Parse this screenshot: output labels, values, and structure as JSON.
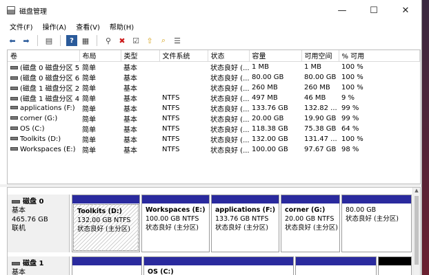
{
  "window": {
    "title": "磁盘管理",
    "minimize": "—",
    "maximize": "☐",
    "close": "✕"
  },
  "menu": [
    "文件(F)",
    "操作(A)",
    "查看(V)",
    "帮助(H)"
  ],
  "toolbar": {
    "icons": [
      "back-arrow-icon",
      "forward-arrow-icon",
      "properties-grid-icon",
      "help-icon",
      "console-tree-icon",
      "connect-icon",
      "delete-icon",
      "checklist-icon",
      "folder-up-icon",
      "search-folder-icon",
      "details-list-icon"
    ]
  },
  "table": {
    "columns": [
      "卷",
      "布局",
      "类型",
      "文件系统",
      "状态",
      "容量",
      "可用空间",
      "% 可用"
    ],
    "rows": [
      [
        "(磁盘 0 磁盘分区 5)",
        "简单",
        "基本",
        "",
        "状态良好 (...",
        "1 MB",
        "1 MB",
        "100 %"
      ],
      [
        "(磁盘 0 磁盘分区 6)",
        "简单",
        "基本",
        "",
        "状态良好 (...",
        "80.00 GB",
        "80.00 GB",
        "100 %"
      ],
      [
        "(磁盘 1 磁盘分区 2)",
        "简单",
        "基本",
        "",
        "状态良好 (...",
        "260 MB",
        "260 MB",
        "100 %"
      ],
      [
        "(磁盘 1 磁盘分区 4)",
        "简单",
        "基本",
        "NTFS",
        "状态良好 (...",
        "497 MB",
        "46 MB",
        "9 %"
      ],
      [
        "applications (F:)",
        "简单",
        "基本",
        "NTFS",
        "状态良好 (...",
        "133.76 GB",
        "132.82 ...",
        "99 %"
      ],
      [
        "corner (G:)",
        "简单",
        "基本",
        "NTFS",
        "状态良好 (...",
        "20.00 GB",
        "19.90 GB",
        "99 %"
      ],
      [
        "OS (C:)",
        "简单",
        "基本",
        "NTFS",
        "状态良好 (...",
        "118.38 GB",
        "75.38 GB",
        "64 %"
      ],
      [
        "Toolkits (D:)",
        "简单",
        "基本",
        "NTFS",
        "状态良好 (...",
        "132.00 GB",
        "131.47 ...",
        "100 %"
      ],
      [
        "Workspaces (E:)",
        "简单",
        "基本",
        "NTFS",
        "状态良好 (...",
        "100.00 GB",
        "97.67 GB",
        "98 %"
      ]
    ]
  },
  "disks": [
    {
      "name": "磁盘 0",
      "type": "基本",
      "size": "465.76 GB",
      "status": "联机",
      "partitions": [
        {
          "name": "Toolkits (D:)",
          "size": "132.00 GB NTFS",
          "status": "状态良好 (主分区)"
        },
        {
          "name": "Workspaces (E:)",
          "size": "100.00 GB NTFS",
          "status": "状态良好 (主分区)"
        },
        {
          "name": "applications (F:)",
          "size": "133.76 GB NTFS",
          "status": "状态良好 (主分区)"
        },
        {
          "name": "corner (G:)",
          "size": "20.00 GB NTFS",
          "status": "状态良好 (主分区)"
        },
        {
          "name": "",
          "size": "80.00 GB",
          "status": "状态良好 (主分区)"
        }
      ]
    },
    {
      "name": "磁盘 1",
      "type": "基本",
      "partitions": [
        {
          "name": ""
        },
        {
          "name": "OS (C:)"
        },
        {
          "name": ""
        },
        {
          "name": ""
        }
      ]
    }
  ]
}
